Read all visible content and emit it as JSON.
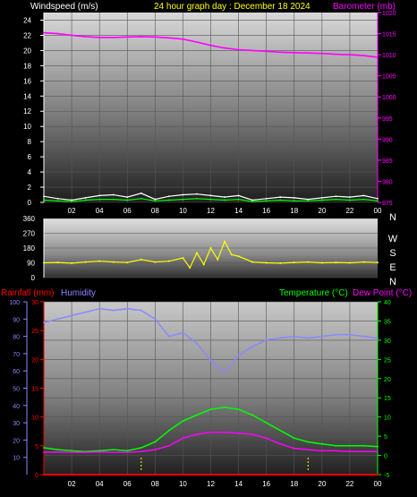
{
  "header": {
    "windspeed_title": "Windspeed (m/s)",
    "date_title": "24 hour graph day : December 18 2024",
    "barometer_title": "Barometer (mb)"
  },
  "colors": {
    "bg": "#000000",
    "white_text": "#ffffff",
    "yellow": "#ffff00",
    "magenta": "#ff00ff",
    "red": "#ff0000",
    "humidity": "#8888ff",
    "green": "#00ff00",
    "wind_white": "#ffffff",
    "wind_green": "#00ff00"
  },
  "chart_data": [
    {
      "type": "line",
      "name": "wind-barometer",
      "title": "24 hour graph day : December 18 2024",
      "xlabel": "",
      "x_ticks": [
        "02",
        "04",
        "06",
        "08",
        "10",
        "12",
        "14",
        "16",
        "18",
        "20",
        "22",
        "00"
      ],
      "xlim": [
        0,
        24
      ],
      "left_axis": {
        "label": "Windspeed (m/s)",
        "ticks": [
          0,
          2,
          4,
          6,
          8,
          10,
          12,
          14,
          16,
          18,
          20,
          22,
          24
        ],
        "range": [
          0,
          25
        ]
      },
      "right_axis": {
        "label": "Barometer (mb)",
        "ticks": [
          975,
          980,
          985,
          990,
          995,
          1000,
          1005,
          1010,
          1015,
          1020
        ],
        "range": [
          975,
          1020
        ]
      },
      "series": [
        {
          "name": "Barometer (mb)",
          "axis": "right",
          "color": "#ff00ff",
          "x": [
            0,
            1,
            2,
            3,
            4,
            5,
            6,
            7,
            8,
            9,
            10,
            11,
            12,
            13,
            14,
            15,
            16,
            17,
            18,
            19,
            20,
            21,
            22,
            23,
            24
          ],
          "y": [
            1015.2,
            1015.0,
            1014.6,
            1014.3,
            1014.1,
            1014.1,
            1014.2,
            1014.3,
            1014.2,
            1014.0,
            1013.7,
            1013.0,
            1012.2,
            1011.6,
            1011.2,
            1011.0,
            1010.8,
            1010.6,
            1010.5,
            1010.4,
            1010.3,
            1010.1,
            1010.0,
            1009.8,
            1009.4
          ]
        },
        {
          "name": "Wind gust",
          "axis": "left",
          "color": "#ffffff",
          "x": [
            0,
            1,
            2,
            3,
            4,
            5,
            6,
            7,
            8,
            9,
            10,
            11,
            12,
            13,
            14,
            15,
            16,
            17,
            18,
            19,
            20,
            21,
            22,
            23,
            24
          ],
          "y": [
            0.8,
            0.5,
            0.3,
            0.6,
            0.9,
            1.0,
            0.7,
            1.2,
            0.4,
            0.8,
            1.0,
            1.1,
            0.9,
            0.7,
            0.9,
            0.3,
            0.5,
            0.7,
            0.6,
            0.4,
            0.6,
            0.8,
            0.7,
            0.9,
            0.5
          ]
        },
        {
          "name": "Wind average",
          "axis": "left",
          "color": "#00ff00",
          "x": [
            0,
            1,
            2,
            3,
            4,
            5,
            6,
            7,
            8,
            9,
            10,
            11,
            12,
            13,
            14,
            15,
            16,
            17,
            18,
            19,
            20,
            21,
            22,
            23,
            24
          ],
          "y": [
            0.3,
            0.2,
            0.1,
            0.3,
            0.4,
            0.4,
            0.3,
            0.5,
            0.2,
            0.3,
            0.4,
            0.5,
            0.4,
            0.3,
            0.4,
            0.1,
            0.2,
            0.3,
            0.2,
            0.2,
            0.3,
            0.4,
            0.3,
            0.4,
            0.2
          ]
        }
      ]
    },
    {
      "type": "scatter",
      "name": "wind-direction",
      "x_ticks": [],
      "xlim": [
        0,
        24
      ],
      "left_axis": {
        "ticks": [
          0,
          90,
          180,
          270,
          360
        ],
        "range": [
          0,
          360
        ]
      },
      "right_labels": [
        "N",
        "W",
        "S",
        "E",
        "N"
      ],
      "series": [
        {
          "name": "Wind direction",
          "color": "#ffff00",
          "x": [
            0,
            1,
            2,
            3,
            4,
            5,
            6,
            7,
            8,
            9,
            10,
            10.5,
            11,
            11.5,
            12,
            12.5,
            13,
            13.5,
            14,
            15,
            16,
            17,
            18,
            19,
            20,
            21,
            22,
            23,
            24
          ],
          "y": [
            90,
            92,
            88,
            95,
            100,
            95,
            92,
            110,
            95,
            100,
            120,
            60,
            150,
            80,
            180,
            110,
            220,
            140,
            130,
            95,
            90,
            88,
            92,
            95,
            90,
            92,
            90,
            95,
            92
          ]
        }
      ]
    },
    {
      "type": "line",
      "name": "temp-humidity-rain",
      "xlim": [
        0,
        24
      ],
      "x_ticks": [
        "02",
        "04",
        "06",
        "08",
        "10",
        "12",
        "14",
        "16",
        "18",
        "20",
        "22",
        "00"
      ],
      "left_axis_rain": {
        "label": "Rainfall (mm)",
        "ticks": [
          0,
          5,
          10,
          15,
          20,
          25,
          30
        ],
        "range": [
          0,
          30
        ]
      },
      "left_axis_humidity": {
        "label": "Humidity",
        "ticks": [
          10,
          20,
          30,
          40,
          50,
          60,
          70,
          80,
          90,
          100
        ],
        "range": [
          0,
          100
        ]
      },
      "right_axis": {
        "label": "Temperature (°C)",
        "label2": "Dew Point (°C)",
        "ticks": [
          -5,
          0,
          5,
          10,
          15,
          20,
          25,
          30,
          35,
          40
        ],
        "range": [
          -5,
          40
        ]
      },
      "series": [
        {
          "name": "Humidity",
          "axis": "humidity",
          "color": "#8888ff",
          "x": [
            0,
            1,
            2,
            3,
            4,
            5,
            6,
            7,
            8,
            9,
            10,
            11,
            12,
            13,
            14,
            15,
            16,
            17,
            18,
            19,
            20,
            21,
            22,
            23,
            24
          ],
          "y": [
            88,
            90,
            92,
            94,
            96,
            95,
            96,
            95,
            90,
            80,
            82,
            76,
            66,
            59,
            69,
            74,
            78,
            79,
            80,
            79,
            80,
            81,
            81,
            80,
            79
          ]
        },
        {
          "name": "Temperature (°C)",
          "axis": "right",
          "color": "#00ff00",
          "x": [
            0,
            1,
            2,
            3,
            4,
            5,
            6,
            7,
            8,
            9,
            10,
            11,
            12,
            13,
            14,
            15,
            16,
            17,
            18,
            19,
            20,
            21,
            22,
            23,
            24
          ],
          "y": [
            2.0,
            1.5,
            1.2,
            1.0,
            1.2,
            1.5,
            1.2,
            2.0,
            3.5,
            6.5,
            9.0,
            10.5,
            12.0,
            12.5,
            12.0,
            10.5,
            8.5,
            6.5,
            4.5,
            3.5,
            3.0,
            2.5,
            2.5,
            2.5,
            2.3
          ]
        },
        {
          "name": "Dew Point (°C)",
          "axis": "right",
          "color": "#ff00ff",
          "x": [
            0,
            1,
            2,
            3,
            4,
            5,
            6,
            7,
            8,
            9,
            10,
            11,
            12,
            13,
            14,
            15,
            16,
            17,
            18,
            19,
            20,
            21,
            22,
            23,
            24
          ],
          "y": [
            0.8,
            0.9,
            0.8,
            0.8,
            0.9,
            0.8,
            0.8,
            1.0,
            1.5,
            2.5,
            4.5,
            5.5,
            6.0,
            6.0,
            5.8,
            5.5,
            4.5,
            3.0,
            1.8,
            1.5,
            1.2,
            1.2,
            1.0,
            1.0,
            1.0
          ]
        },
        {
          "name": "Rainfall (mm)",
          "axis": "rain",
          "color": "#ff0000",
          "x": [
            0,
            24
          ],
          "y": [
            0,
            0
          ]
        }
      ],
      "markers": [
        7,
        19
      ]
    }
  ]
}
